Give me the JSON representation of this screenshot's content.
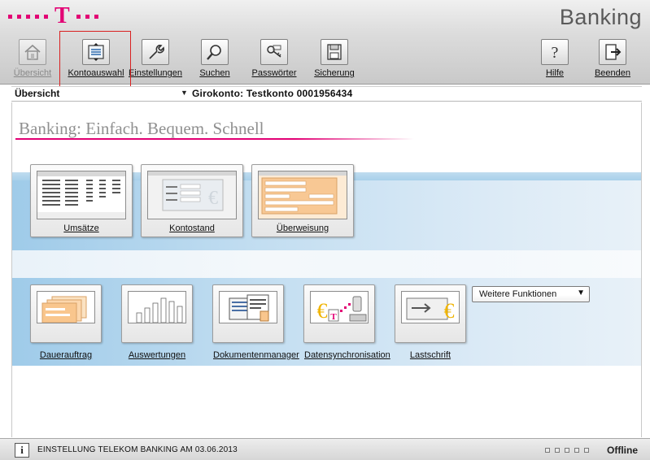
{
  "header": {
    "app_title": "Banking",
    "logo_letter": "T",
    "brand_color": "#e20074"
  },
  "toolbar": {
    "overview": "Übersicht",
    "account_select": "Kontoauswahl",
    "settings": "Einstellungen",
    "search": "Suchen",
    "passwords": "Passwörter",
    "backup": "Sicherung",
    "help": "Hilfe",
    "quit": "Beenden",
    "icons": [
      "home-icon",
      "account-select-icon",
      "wrench-icon",
      "magnifier-icon",
      "key-icon",
      "floppy-disk-icon",
      "help-icon",
      "exit-icon"
    ]
  },
  "account_bar": {
    "view": "Übersicht",
    "account": "Girokonto: Testkonto  0001956434"
  },
  "main": {
    "slogan": "Banking: Einfach. Bequem. Schnell",
    "tiles_large": [
      "Umsätze",
      "Kontostand",
      "Überweisung"
    ],
    "tiles_small": [
      "Dauerauftrag",
      "Auswertungen",
      "Dokumentenmanager",
      "Datensynchronisation",
      "Lastschrift"
    ],
    "more_select": "Weitere Funktionen"
  },
  "status": {
    "message": "EINSTELLUNG TELEKOM BANKING AM 03.06.2013",
    "info_glyph": "i",
    "connection": "Offline"
  }
}
